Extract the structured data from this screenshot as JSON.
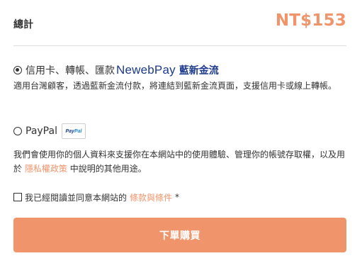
{
  "summary": {
    "total_label": "總計",
    "total_amount": "NT$153"
  },
  "payment": {
    "newebpay": {
      "label": "信用卡、轉帳、匯款",
      "brand_en": "NewebPay",
      "brand_cn": "藍新金流",
      "description": "適用台灣顧客，透過藍新金流付款，將連結到藍新金流頁面，支援信用卡或線上轉帳。",
      "selected": true
    },
    "paypal": {
      "label": "PayPal",
      "badge_pay": "Pay",
      "badge_pal": "Pal",
      "selected": false
    }
  },
  "privacy": {
    "text_before": "我們會使用你的個人資料來支援你在本網站中的使用體驗、管理你的帳號存取權，以及用於",
    "link": "隱私權政策",
    "text_after": "中說明的其他用途。"
  },
  "terms": {
    "text": "我已經閱讀並同意本網站的",
    "link": "條款與條件",
    "required": "*",
    "checked": false
  },
  "submit": {
    "label": "下單購買"
  },
  "colors": {
    "accent": "#f0956b",
    "newebpay_brand": "#1c3a8c",
    "text": "#333333",
    "divider": "#dcdcdc"
  },
  "icons": {
    "newebpay_radio": "radio-checked",
    "paypal_radio": "radio-unchecked",
    "paypal_logo": "paypal-logo",
    "terms_checkbox": "checkbox-unchecked"
  }
}
